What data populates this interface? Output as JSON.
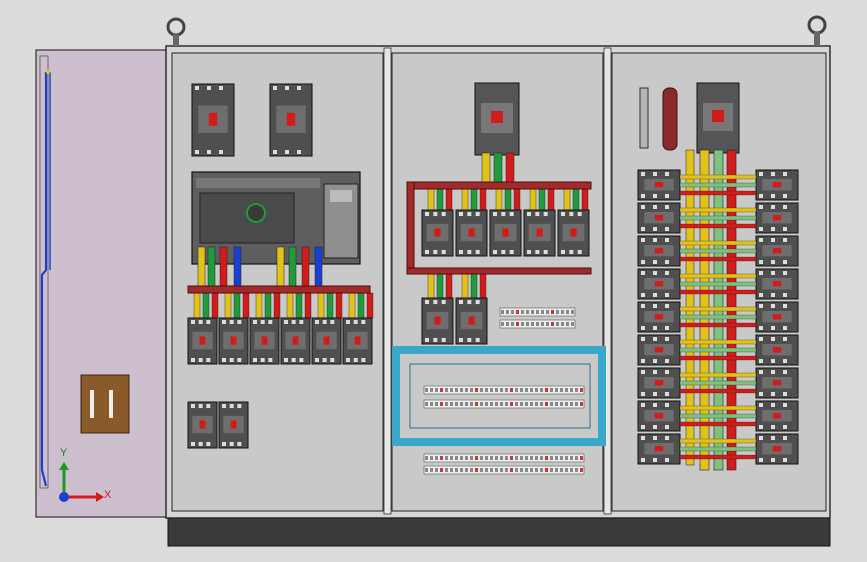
{
  "viewport": {
    "background": "#dcdcdc",
    "axis_triad": {
      "x_label": "X",
      "y_label": "Y",
      "x_color": "#d11c1c",
      "y_color": "#1e9a1e",
      "z_color": "#1c3fd1"
    }
  },
  "cabinet": {
    "frame_color": "#d6d6d6",
    "panel_color": "#c9c9c9",
    "plinth_color": "#3a3a3a",
    "door_color": "#cdbfcd",
    "left_section": {
      "top_breakers": 2,
      "mid_breakers": 6,
      "bottom_breakers": 2,
      "wire_colors": [
        "#e0c21a",
        "#1f9b3a",
        "#d11c1c",
        "#1c3fd1"
      ]
    },
    "middle_section": {
      "upper_breakers": 5,
      "lower_breakers": 2,
      "duct_color": "#3aa6c8"
    },
    "right_section": {
      "breaker_rows": 9,
      "bus_colors": [
        "#e0c21a",
        "#7ec27e",
        "#d11c1c"
      ]
    }
  }
}
